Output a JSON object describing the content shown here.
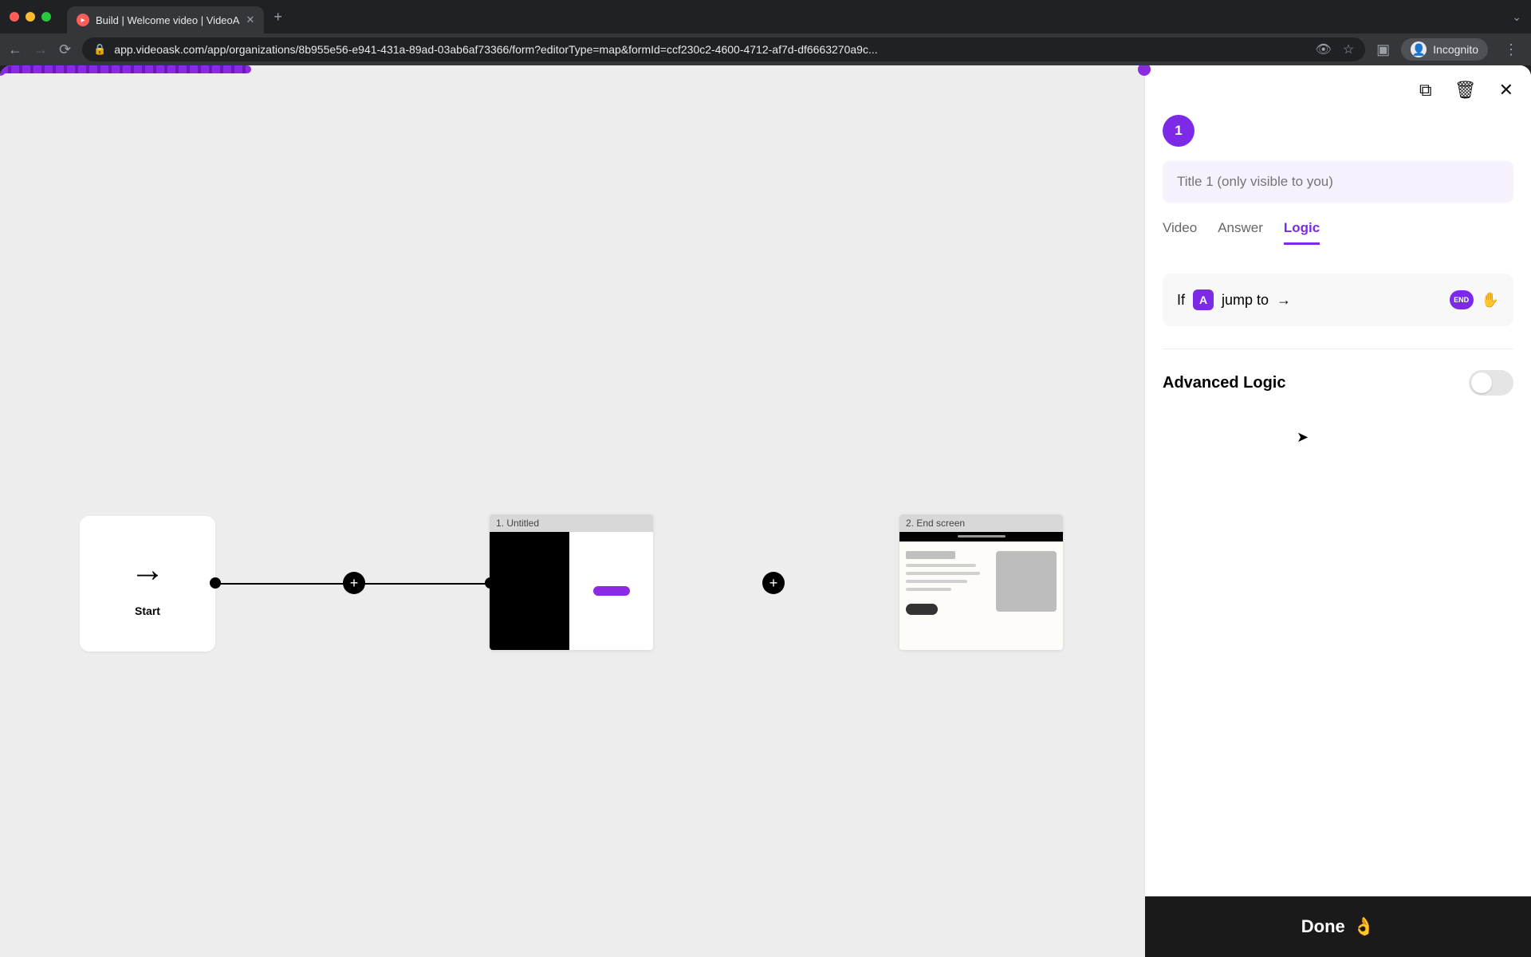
{
  "browser": {
    "tab_title": "Build | Welcome video | VideoA",
    "url": "app.videoask.com/app/organizations/8b955e56-e941-431a-89ad-03ab6af73366/form?editorType=map&formId=ccf230c2-4600-4712-af7d-df6663270a9c...",
    "incognito_label": "Incognito"
  },
  "canvas": {
    "start_label": "Start",
    "step1_label": "1. Untitled",
    "step2_label": "2. End screen"
  },
  "panel": {
    "step_number": "1",
    "title_placeholder": "Title 1 (only visible to you)",
    "tabs": {
      "video": "Video",
      "answer": "Answer",
      "logic": "Logic",
      "active": "logic"
    },
    "logic": {
      "if_label": "If",
      "chip": "A",
      "jump_label": "jump to",
      "end_chip": "END"
    },
    "advanced_label": "Advanced Logic",
    "advanced_on": false,
    "done_label": "Done"
  },
  "colors": {
    "accent": "#7d2ae8"
  }
}
